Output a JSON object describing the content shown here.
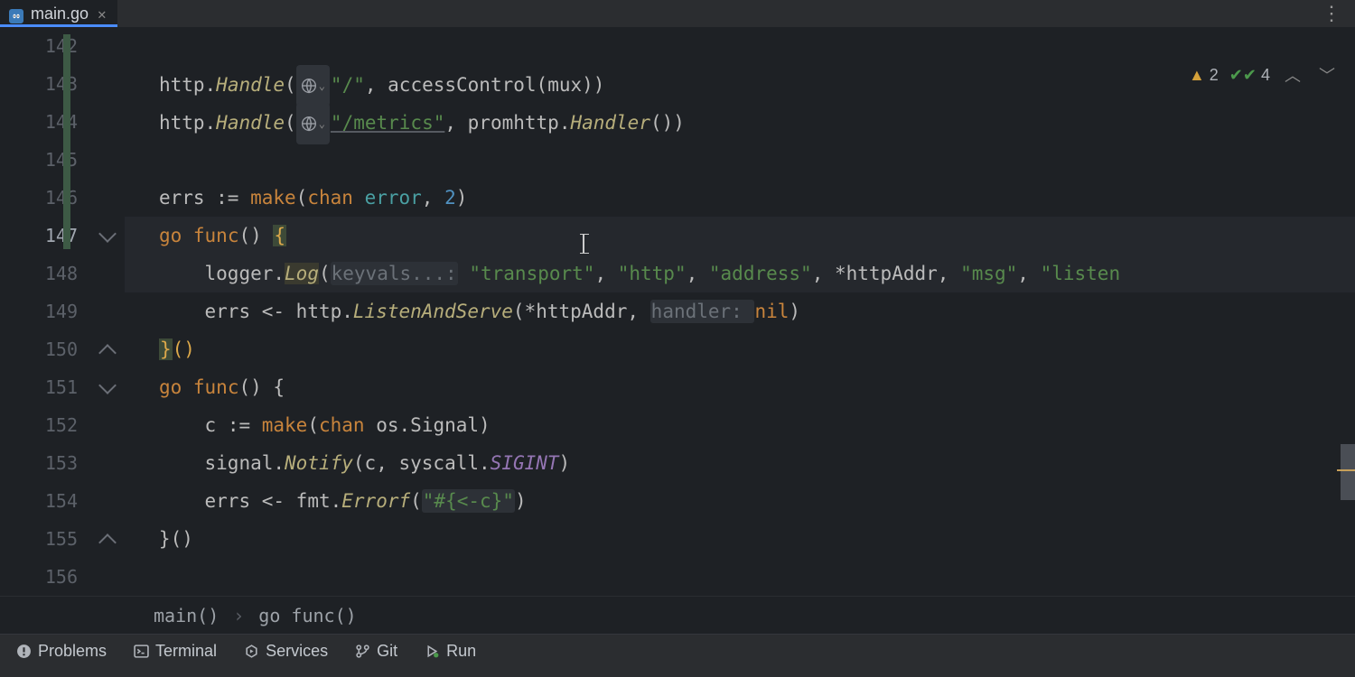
{
  "tab": {
    "filename": "main.go"
  },
  "inspections": {
    "warnings": "2",
    "checks": "4"
  },
  "gutter": {
    "start": 142,
    "end": 156,
    "active": 147,
    "folds": [
      147,
      150,
      151,
      155
    ],
    "fold_close": [
      150,
      155
    ]
  },
  "code": {
    "l143_pkg": "http",
    "l143_fn": "Handle",
    "l143_route": "\"/\"",
    "l143_call": "accessControl",
    "l143_arg": "mux",
    "l144_pkg": "http",
    "l144_fn": "Handle",
    "l144_route": "\"/metrics\"",
    "l144_pkg2": "promhttp",
    "l144_fn2": "Handler",
    "l146_var": "errs",
    "l146_make": "make",
    "l146_chan": "chan",
    "l146_type": "error",
    "l146_n": "2",
    "l147_go": "go",
    "l147_func": "func",
    "l148_obj": "logger",
    "l148_fn": "Log",
    "l148_hint": "keyvals...:",
    "l148_s1": "\"transport\"",
    "l148_s2": "\"http\"",
    "l148_s3": "\"address\"",
    "l148_addr": "httpAddr",
    "l148_s4": "\"msg\"",
    "l148_s5": "\"listen",
    "l149_var": "errs",
    "l149_pkg": "http",
    "l149_fn": "ListenAndServe",
    "l149_addr": "httpAddr",
    "l149_hint": "handler:",
    "l149_nil": "nil",
    "l151_go": "go",
    "l151_func": "func",
    "l152_var": "c",
    "l152_make": "make",
    "l152_chan": "chan",
    "l152_pkg": "os",
    "l152_type": "Signal",
    "l153_pkg": "signal",
    "l153_fn": "Notify",
    "l153_arg": "c",
    "l153_pkg2": "syscall",
    "l153_const": "SIGINT",
    "l154_var": "errs",
    "l154_pkg": "fmt",
    "l154_fn": "Errorf",
    "l154_str": "\"#{<-c}\""
  },
  "breadcrumb": {
    "item1": "main()",
    "item2": "go func()"
  },
  "toolbar": {
    "problems": "Problems",
    "terminal": "Terminal",
    "services": "Services",
    "git": "Git",
    "run": "Run"
  }
}
